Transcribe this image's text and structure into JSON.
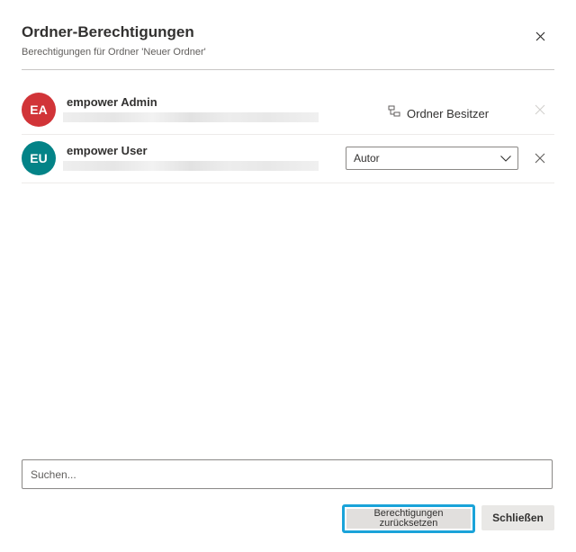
{
  "dialog": {
    "title": "Ordner-Berechtigungen",
    "subtitle": "Berechtigungen für Ordner 'Neuer Ordner'",
    "close_icon": "close-icon"
  },
  "users": [
    {
      "initials": "EA",
      "name": "empower Admin",
      "avatar_color": "#d13438",
      "role_label": "Ordner Besitzer",
      "role_icon": "hierarchy-icon",
      "remove_enabled": false
    },
    {
      "initials": "EU",
      "name": "empower User",
      "avatar_color": "#038387",
      "role_value": "Autor",
      "remove_enabled": true
    }
  ],
  "search": {
    "placeholder": "Suchen...",
    "value": ""
  },
  "footer": {
    "reset_label": "Berechtigungen zurücksetzen",
    "close_label": "Schließen"
  },
  "colors": {
    "focus_outline": "#1aa3d9",
    "divider": "#c8c6c4"
  }
}
